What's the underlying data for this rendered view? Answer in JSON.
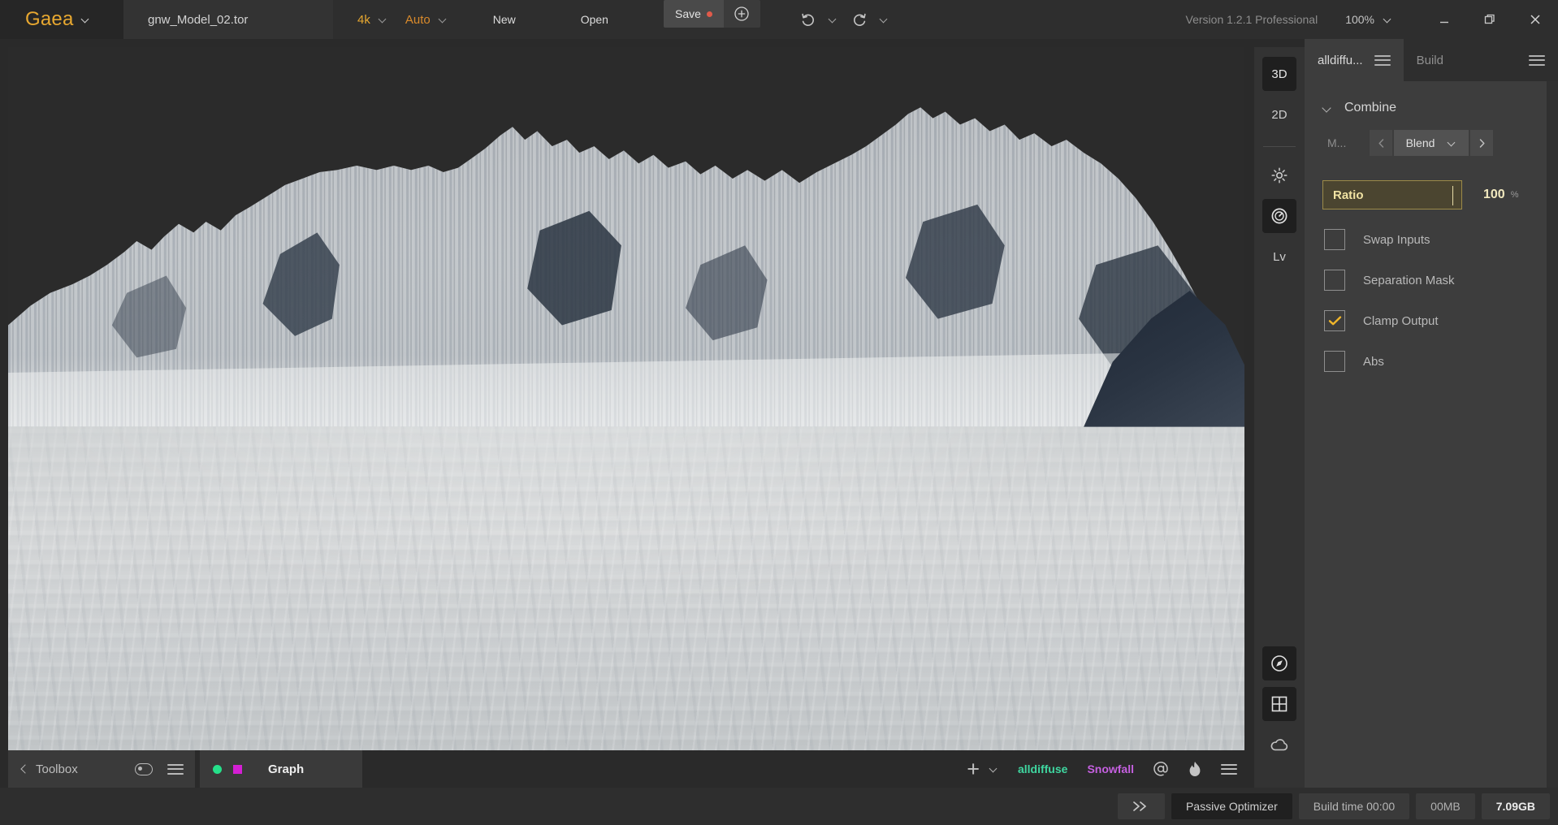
{
  "app": {
    "brand": "Gaea",
    "filename": "gnw_Model_02.tor",
    "resolution": "4k",
    "quality": "Auto",
    "version": "Version 1.2.1 Professional",
    "zoom": "100%"
  },
  "topbar": {
    "new_label": "New",
    "open_label": "Open",
    "save_label": "Save",
    "save_plus_icon": "plus-circle-icon",
    "undo_icon": "undo-icon",
    "redo_icon": "redo-icon",
    "brand_chevron_icon": "chevron-down-icon",
    "resolution_chevron_icon": "chevron-down-icon",
    "quality_chevron_icon": "chevron-down-icon",
    "zoom_chevron_icon": "chevron-down-icon",
    "minimize_icon": "minimize-icon",
    "restore_icon": "restore-icon",
    "close_icon": "close-icon",
    "save_modified_dot": "unsaved-indicator"
  },
  "viewport_toolbar": {
    "items": [
      {
        "label": "3D",
        "name": "view-3d",
        "active": true
      },
      {
        "label": "2D",
        "name": "view-2d",
        "active": false
      }
    ],
    "icons": [
      {
        "name": "light-sun-icon",
        "active": false
      },
      {
        "name": "dial-knob-icon",
        "active": true
      },
      {
        "label": "Lv",
        "name": "level-button",
        "active": false
      }
    ],
    "bottom_icons": [
      {
        "name": "compass-icon",
        "active": true
      },
      {
        "name": "grid-icon",
        "active": true
      },
      {
        "name": "cloud-icon",
        "active": false
      }
    ]
  },
  "viewport": {
    "scene_name": "snowy-mountain-terrain-render",
    "sky_color": "#2b2b2b",
    "snow_color": "#d4d7d8"
  },
  "dock": {
    "toolbox_label": "Toolbox",
    "back_icon": "chevron-left-icon",
    "toolbox_pill_icon": "pill-toggle-icon",
    "toolbox_menu_icon": "hamburger-menu-icon",
    "graph_label": "Graph",
    "graph_dot_green": "#25e08a",
    "graph_square_magenta": "#d41fd4",
    "add_icon": "plus-icon",
    "add_chevron_icon": "chevron-down-icon",
    "tags": [
      {
        "label": "alldiffuse",
        "color": "#3fd7a0"
      },
      {
        "label": "Snowfall",
        "color": "#c560e0"
      }
    ],
    "at_icon": "at-icon",
    "flame_icon": "flame-icon",
    "menu_icon": "hamburger-menu-icon"
  },
  "panel": {
    "tab_active": "alldiffu...",
    "tab_active_menu_icon": "hamburger-menu-icon",
    "tab_build": "Build",
    "tab_build_menu_icon": "hamburger-menu-icon",
    "group": {
      "collapse_icon": "chevron-down-icon",
      "title": "Combine"
    },
    "mode": {
      "label": "M...",
      "prev_icon": "chevron-left-icon",
      "value": "Blend",
      "value_chevron_icon": "chevron-down-icon",
      "next_icon": "chevron-right-icon"
    },
    "ratio": {
      "field_value": "Ratio",
      "number": "100",
      "unit": "%"
    },
    "checkboxes": [
      {
        "label": "Swap Inputs",
        "checked": false,
        "name": "checkbox-swap-inputs"
      },
      {
        "label": "Separation Mask",
        "checked": false,
        "name": "checkbox-separation-mask"
      },
      {
        "label": "Clamp Output",
        "checked": true,
        "name": "checkbox-clamp-output"
      },
      {
        "label": "Abs",
        "checked": false,
        "name": "checkbox-abs"
      }
    ],
    "accent_color": "#e8a830"
  },
  "statusbar": {
    "advance_icon": "fast-forward-icon",
    "optimizer_label": "Passive Optimizer",
    "build_time": "Build time 00:00",
    "memory_mb": "00MB",
    "memory_gb": "7.09GB"
  }
}
